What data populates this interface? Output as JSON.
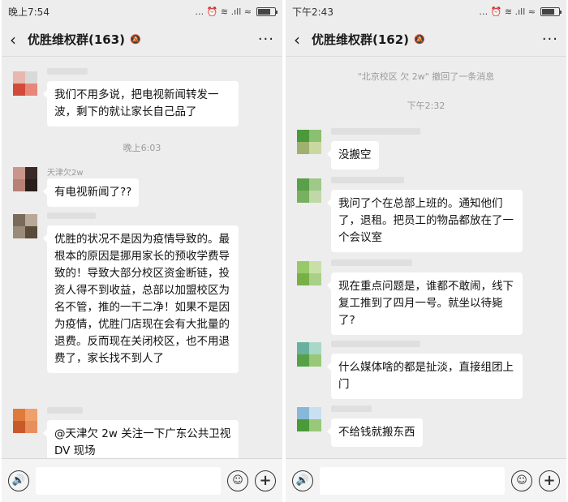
{
  "colors": {
    "background": "#ededed",
    "bubble": "#ffffff",
    "accent": "#333333"
  },
  "left": {
    "status": {
      "time": "晚上7:54",
      "icons": "… ⏰ ≋ .ıll ≈"
    },
    "header": {
      "back_icon": "chevron-left-icon",
      "title": "优胜维权群(163)",
      "mute_icon": "bell-off-icon",
      "more": "···"
    },
    "messages": [
      {
        "text": "我们不用多说，把电视新闻转发一波，剩下的就让家长自己品了"
      },
      {
        "systime": "晚上6:03"
      },
      {
        "sender": "天津欠2w",
        "text": "有电视新闻了??"
      },
      {
        "text": "优胜的状况不是因为疫情导致的。最根本的原因是挪用家长的预收学费导致的！导致大部分校区资金断链，投资人得不到收益，总部以加盟校区为名不管，推的一干二净！如果不是因为疫情，优胜门店现在会有大批量的退费。反而现在关闭校区，也不用退费了，家长找不到人了"
      },
      {
        "text": "@天津欠 2w  关注一下广东公共卫视 DV 现场"
      }
    ]
  },
  "right": {
    "status": {
      "time": "下午2:43",
      "icons": "… ⏰ ≋ .ıll ≈"
    },
    "header": {
      "back_icon": "chevron-left-icon",
      "title": "优胜维权群(162)",
      "mute_icon": "bell-off-icon",
      "more": "···"
    },
    "recall": "\"北京校区 欠 2w\" 撤回了一条消息",
    "systime": "下午2:32",
    "messages": [
      {
        "text": "没搬空"
      },
      {
        "text": "我问了个在总部上班的。通知他们了，退租。把员工的物品都放在了一个会议室"
      },
      {
        "text": "现在重点问题是，谁都不敢闹，线下复工推到了四月一号。就坐以待毙了?"
      },
      {
        "text": "什么媒体啥的都是扯淡，直接组团上门"
      },
      {
        "text": "不给钱就搬东西"
      }
    ]
  },
  "inputbar": {
    "voice_icon": "voice-icon",
    "emoji_icon": "emoji-icon",
    "plus_icon": "plus-icon",
    "voice": "🔊",
    "emoji": "☺",
    "plus": "+"
  }
}
